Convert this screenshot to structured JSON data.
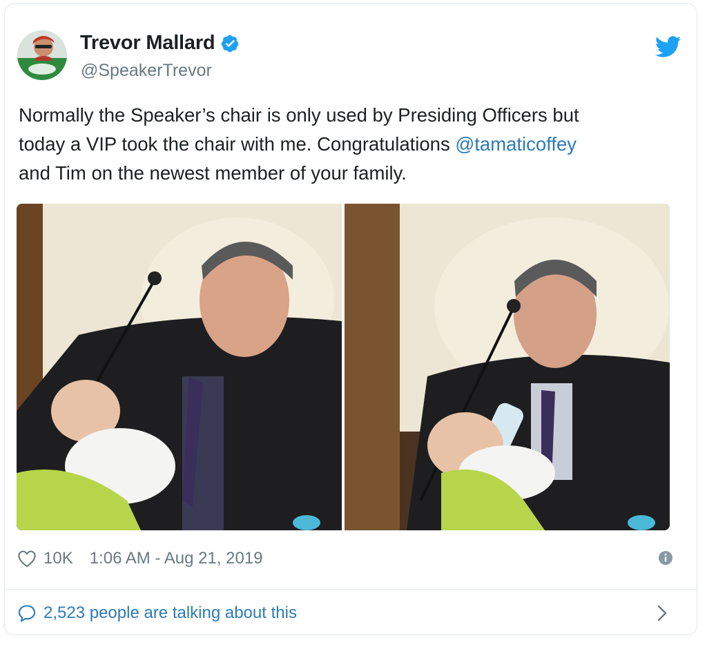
{
  "tweet": {
    "author_name": "Trevor Mallard",
    "handle": "@SpeakerTrevor",
    "verified": true,
    "text_parts": {
      "line1": "Normally the Speaker’s chair is only used by Presiding Officers but",
      "line2_pre": "today a VIP took the chair with me. Congratulations ",
      "mention": "@tamaticoffey",
      "line3": "and Tim on the newest member of your family."
    },
    "likes": "10K",
    "timestamp": "1:06 AM - Aug 21, 2019",
    "talking": "2,523 people are talking about this"
  },
  "icons": {
    "verified": "verified-badge-icon",
    "brand": "twitter-bird-icon",
    "like": "heart-icon",
    "info": "info-icon",
    "reply": "speech-bubble-icon",
    "chevron": "chevron-right-icon"
  },
  "colors": {
    "brand_blue": "#1da1f2",
    "link_blue": "#2b7bb9",
    "muted_gray": "#697882",
    "text": "#1c2022",
    "border": "#e1e8ed"
  }
}
